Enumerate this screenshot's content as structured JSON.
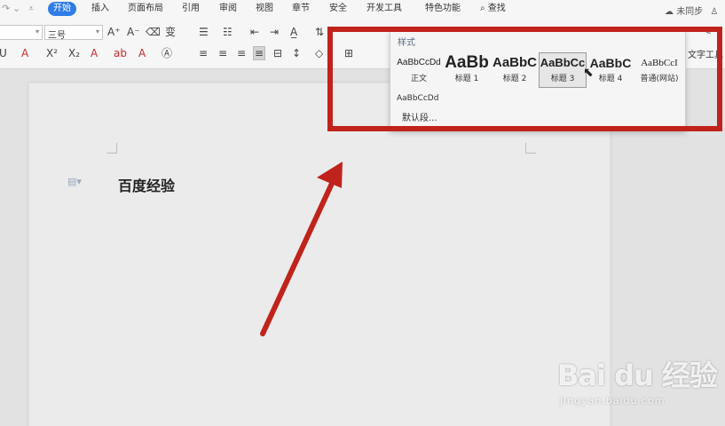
{
  "menu": {
    "items": [
      "开始",
      "插入",
      "页面布局",
      "引用",
      "审阅",
      "视图",
      "章节",
      "安全",
      "开发工具",
      "特色功能"
    ],
    "search": "查找",
    "sync": "未同步"
  },
  "ribbon": {
    "font_size": "三号",
    "text_tool": "文字工具"
  },
  "styles_panel": {
    "title": "样式",
    "styles": [
      {
        "sample": "AaBbCcDd",
        "name": "正文"
      },
      {
        "sample": "AaBb",
        "name": "标题 1"
      },
      {
        "sample": "AaBbC",
        "name": "标题 2"
      },
      {
        "sample": "AaBbCc",
        "name": "标题 3"
      },
      {
        "sample": "AaBbC",
        "name": "标题 4"
      },
      {
        "sample": "AaBbCcI",
        "name": "普通(网站)"
      }
    ],
    "default_sample": "AaBbCcDd",
    "more_label": "默认段..."
  },
  "document": {
    "text": "百度经验"
  },
  "watermark": {
    "brand": "Bai du 经验",
    "url": "jingyan.baidu.com"
  },
  "colors": {
    "accent": "#2f7ce6",
    "annotation_red": "#c0231c"
  }
}
